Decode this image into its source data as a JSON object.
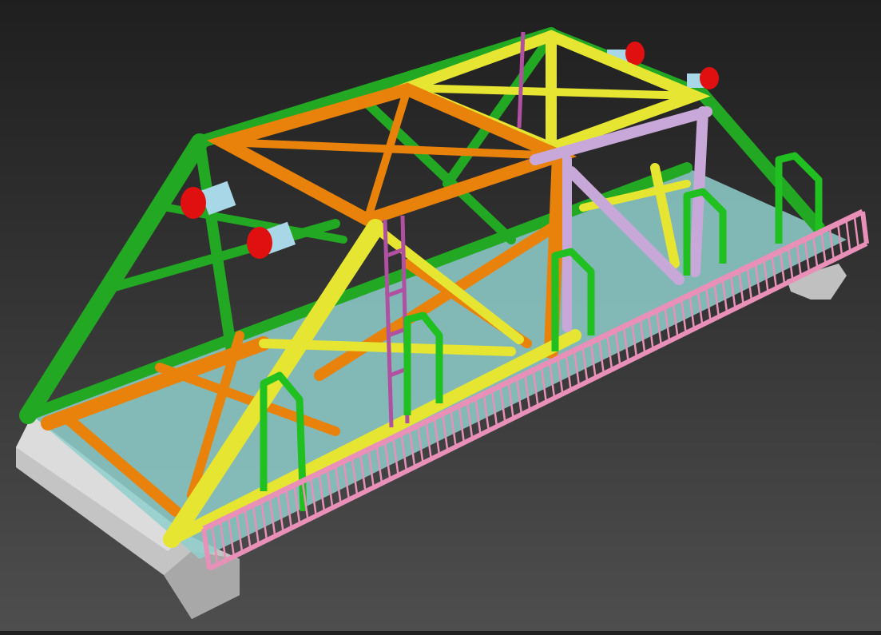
{
  "scene": {
    "subject": "truss-bridge-3d-model",
    "colors": {
      "background_top": "#1f1f1f",
      "background_bottom": "#4e4e4e",
      "far_truss": "#22a822",
      "near_truss_yellow": "#e6e632",
      "near_truss_orange": "#e8820a",
      "portal_lavender": "#c8a8d8",
      "railing": "#e890b8",
      "deck": "#9adcd8",
      "abutment": "#c8c8c8",
      "lamp": "#e01010",
      "lamp_mount": "#a8d8e8",
      "handrail_green": "#20c020",
      "ladder": "#b050a0"
    }
  }
}
